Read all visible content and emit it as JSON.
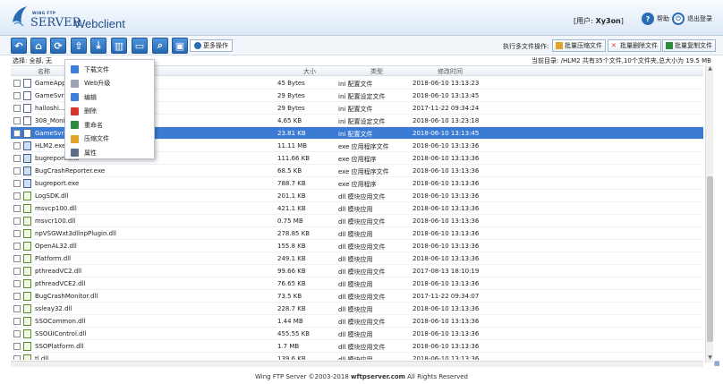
{
  "header": {
    "brand_small": "WING FTP",
    "brand_server": "SERVER",
    "brand_title": "Webclient",
    "user_prefix": "[用户:",
    "user_name": " Xy3on",
    "user_suffix": "]",
    "help_label": "帮助",
    "logout_label": "退出登录"
  },
  "toolbar": {
    "buttons": [
      "back",
      "home",
      "refresh",
      "upload",
      "download",
      "delete",
      "folder",
      "search",
      "monitor"
    ],
    "more_label": "更多操作",
    "batch_label": "执行多文件操作:",
    "batch_compress": "批量压缩文件",
    "batch_delete": "批量删除文件",
    "batch_copy": "批量复制文件"
  },
  "selection_info": "选择: 全部, 无",
  "path_info": "当前目录: /HLM2    共有35个文件,10个文件夹,总大小为 19.5 MB",
  "columns": {
    "name": "名称",
    "size": "大小",
    "type": "类型",
    "time": "修改时间"
  },
  "files": [
    {
      "name": "GameAppl...",
      "size": "45 Bytes",
      "type": "ini 配置文件",
      "time": "2018-06-10 13:13:23",
      "kind": "txt"
    },
    {
      "name": "GameSvrl...",
      "size": "29 Bytes",
      "type": "ini 配置设定文件",
      "time": "2018-06-10 13:13:45",
      "kind": "txt"
    },
    {
      "name": "halloshi...",
      "size": "29 Bytes",
      "type": "ini 配置文件",
      "time": "2017-11-22 09:34:24",
      "kind": "txt"
    },
    {
      "name": "308_Monit...",
      "size": "4.65 KB",
      "type": "ini 配置设定文件",
      "time": "2018-06-10 13:23:18",
      "kind": "txt"
    },
    {
      "name": "GameSvrl...",
      "size": "23.81 KB",
      "type": "ini 配置文件",
      "time": "2018-06-10 13:13:45",
      "kind": "txt",
      "selected": true
    },
    {
      "name": "HLM2.exe",
      "size": "11.11 MB",
      "type": "exe 应用程序文件",
      "time": "2018-06-10 13:13:36",
      "kind": "exe"
    },
    {
      "name": "bugreport.exe",
      "size": "111.66 KB",
      "type": "exe 应用程序",
      "time": "2018-06-10 13:13:36",
      "kind": "exe"
    },
    {
      "name": "BugCrashReporter.exe",
      "size": "68.5 KB",
      "type": "exe 应用程序文件",
      "time": "2018-06-10 13:13:36",
      "kind": "exe"
    },
    {
      "name": "bugreport.exe",
      "size": "788.7 KB",
      "type": "exe 应用程序",
      "time": "2018-06-10 13:13:36",
      "kind": "exe"
    },
    {
      "name": "LogSDK.dll",
      "size": "201.1 KB",
      "type": "dll 模块应用文件",
      "time": "2018-06-10 13:13:36",
      "kind": "dll"
    },
    {
      "name": "msvcp100.dll",
      "size": "421.1 KB",
      "type": "dll 模块应用",
      "time": "2018-06-10 13:13:36",
      "kind": "dll"
    },
    {
      "name": "msvcr100.dll",
      "size": "0.75 MB",
      "type": "dll 模块应用文件",
      "time": "2018-06-10 13:13:36",
      "kind": "dll"
    },
    {
      "name": "npVSGWxt3dllnpPlugin.dll",
      "size": "278.85 KB",
      "type": "dll 模块应用",
      "time": "2018-06-10 13:13:36",
      "kind": "dll"
    },
    {
      "name": "OpenAL32.dll",
      "size": "155.8 KB",
      "type": "dll 模块应用文件",
      "time": "2018-06-10 13:13:36",
      "kind": "dll"
    },
    {
      "name": "Platform.dll",
      "size": "249.1 KB",
      "type": "dll 模块应用",
      "time": "2018-06-10 13:13:36",
      "kind": "dll"
    },
    {
      "name": "pthreadVC2.dll",
      "size": "99.66 KB",
      "type": "dll 模块应用文件",
      "time": "2017-08-13 18:10:19",
      "kind": "dll"
    },
    {
      "name": "pthreadVCE2.dll",
      "size": "76.65 KB",
      "type": "dll 模块应用",
      "time": "2018-06-10 13:13:36",
      "kind": "dll"
    },
    {
      "name": "BugCrashMonitor.dll",
      "size": "73.5 KB",
      "type": "dll 模块应用文件",
      "time": "2017-11-22 09:34:07",
      "kind": "dll"
    },
    {
      "name": "ssleay32.dll",
      "size": "228.7 KB",
      "type": "dll 模块应用",
      "time": "2018-06-10 13:13:36",
      "kind": "dll"
    },
    {
      "name": "SSOCommon.dll",
      "size": "1.44 MB",
      "type": "dll 模块应用文件",
      "time": "2018-06-10 13:13:36",
      "kind": "dll"
    },
    {
      "name": "SSOUIControl.dll",
      "size": "455.55 KB",
      "type": "dll 模块应用",
      "time": "2018-06-10 13:13:36",
      "kind": "dll"
    },
    {
      "name": "SSOPlatform.dll",
      "size": "1.7 MB",
      "type": "dll 模块应用文件",
      "time": "2018-06-10 13:13:36",
      "kind": "dll"
    },
    {
      "name": "tl.dll",
      "size": "139.6 KB",
      "type": "dll 模块应用",
      "time": "2018-06-10 13:13:36",
      "kind": "dll"
    }
  ],
  "context_menu": [
    {
      "label": "下载文件",
      "color": "#3b7dd8"
    },
    {
      "label": "Web升级",
      "color": "#9aa6b5"
    },
    {
      "label": "编辑",
      "color": "#3b7dd8"
    },
    {
      "label": "删除",
      "color": "#d9342b"
    },
    {
      "label": "重命名",
      "color": "#2a8c3c"
    },
    {
      "label": "压缩文件",
      "color": "#e0a526"
    },
    {
      "label": "属性",
      "color": "#5a6d88"
    }
  ],
  "footer": {
    "prefix": "Wing FTP Server ©2003-2018 ",
    "domain": "wftpserver.com",
    "suffix": " All Rights Reserved"
  },
  "colors": {
    "accent": "#2a6db7",
    "selected_row": "#3c7bd3"
  }
}
